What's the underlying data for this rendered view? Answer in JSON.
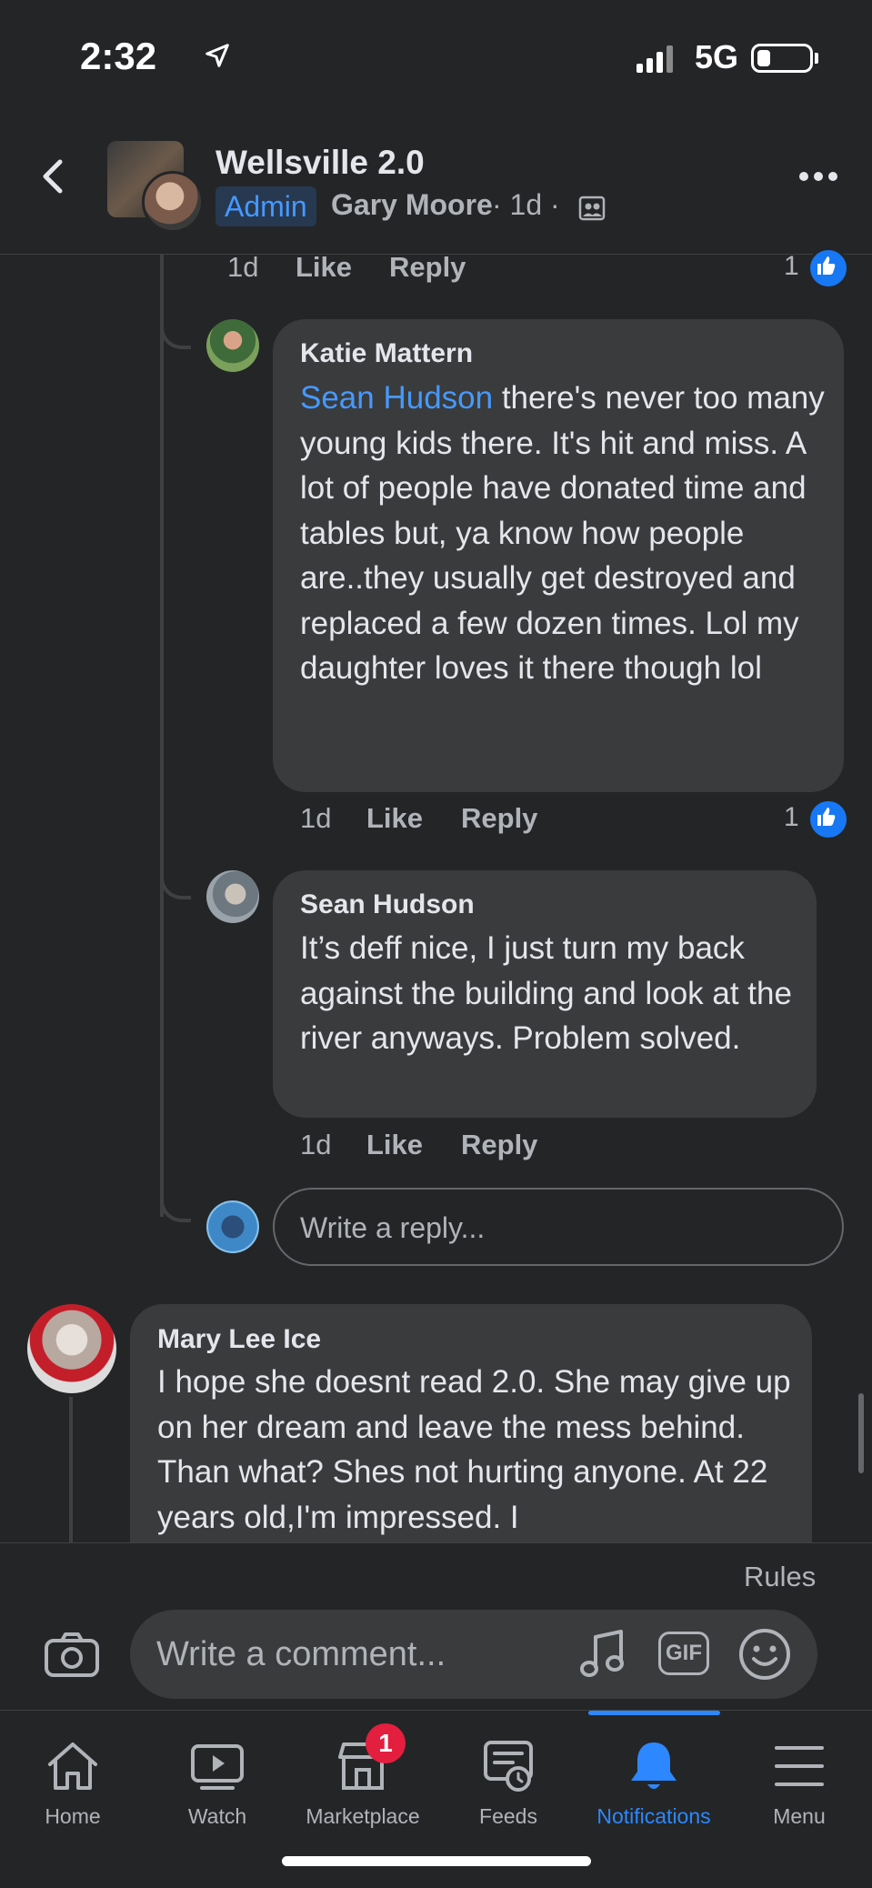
{
  "status_bar": {
    "time": "2:32",
    "network": "5G"
  },
  "header": {
    "group_name": "Wellsville 2.0",
    "admin_badge": "Admin",
    "author": "Gary Moore",
    "meta": "· 1d ·"
  },
  "top_actions": {
    "time": "1d",
    "like": "Like",
    "reply": "Reply",
    "reaction_count": "1"
  },
  "comments": [
    {
      "author": "Katie Mattern",
      "mention": "Sean Hudson",
      "text": " there's never too many young kids there. It's hit and miss. A lot of people have donated time and tables but, ya know how people are..they usually get destroyed and replaced a few dozen times. Lol my daughter loves it there though lol",
      "time": "1d",
      "like": "Like",
      "reply": "Reply",
      "reaction_count": "1"
    },
    {
      "author": "Sean Hudson",
      "text": "It’s deff nice, I just turn my back against the building and look at the river anyways. Problem solved.",
      "time": "1d",
      "like": "Like",
      "reply": "Reply"
    },
    {
      "author": "Mary Lee Ice",
      "text": "I hope she doesnt read 2.0. She may give up on her dream and leave the mess behind. Than what?  Shes not hurting anyone. At 22 years old,I'm impressed.  I"
    }
  ],
  "reply_input": {
    "placeholder": "Write a reply..."
  },
  "composer": {
    "rules": "Rules",
    "placeholder": "Write a comment...",
    "gif": "GIF"
  },
  "nav": {
    "items": [
      {
        "label": "Home",
        "icon": "home-icon"
      },
      {
        "label": "Watch",
        "icon": "video-icon"
      },
      {
        "label": "Marketplace",
        "icon": "shop-icon",
        "badge": "1"
      },
      {
        "label": "Feeds",
        "icon": "feeds-icon"
      },
      {
        "label": "Notifications",
        "icon": "bell-icon",
        "active": true
      },
      {
        "label": "Menu",
        "icon": "menu-icon"
      }
    ]
  },
  "colors": {
    "background": "#242526",
    "bubble": "#3a3b3c",
    "accent": "#2d88ff",
    "mention": "#4599ff",
    "badge": "#e41e3f"
  }
}
